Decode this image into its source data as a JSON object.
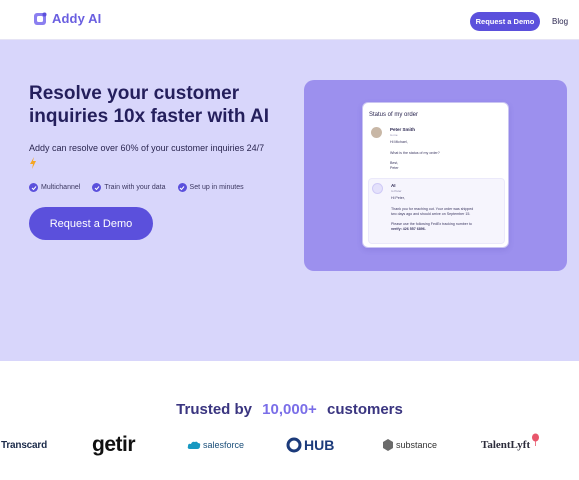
{
  "header": {
    "brand": "Addy AI",
    "request_demo": "Request a Demo",
    "blog": "Blog"
  },
  "hero": {
    "title": "Resolve your customer inquiries 10x faster with AI",
    "subtitle": "Addy can resolve over 60% of your customer inquiries 24/7",
    "features": [
      "Multichannel",
      "Train with your data",
      "Set up in minutes"
    ],
    "cta": "Request a Demo"
  },
  "demo_card": {
    "title": "Status of my order",
    "user": {
      "name": "Peter Smith",
      "to": "to me",
      "greeting": "Hi Michael,",
      "body": "What is the status of my order?",
      "signoff": "Best,",
      "signature": "Peter"
    },
    "ai": {
      "name": "AI",
      "to": "to Peter",
      "greeting": "Hi Peter,",
      "line1": "Thank you for reaching out. Your order was shipped",
      "line2": "two days ago and should arrive on September 15.",
      "line3": "Please use the following FedEx tracking number to",
      "line4": "verify: 426 557 6896."
    }
  },
  "trusted": {
    "prefix": "Trusted by",
    "count": "10,000+",
    "suffix": "customers"
  },
  "logos": {
    "transcard": "Transcard",
    "getir": "getir",
    "salesforce": "salesforce",
    "hub": "HUB",
    "substance": "substance",
    "talentlyft": "TalentLyft"
  },
  "colors": {
    "brand": "#5b50dc",
    "hero_bg": "#d8d6fb",
    "panel_bg": "#9c90ee",
    "accent": "#7a6ee8"
  }
}
